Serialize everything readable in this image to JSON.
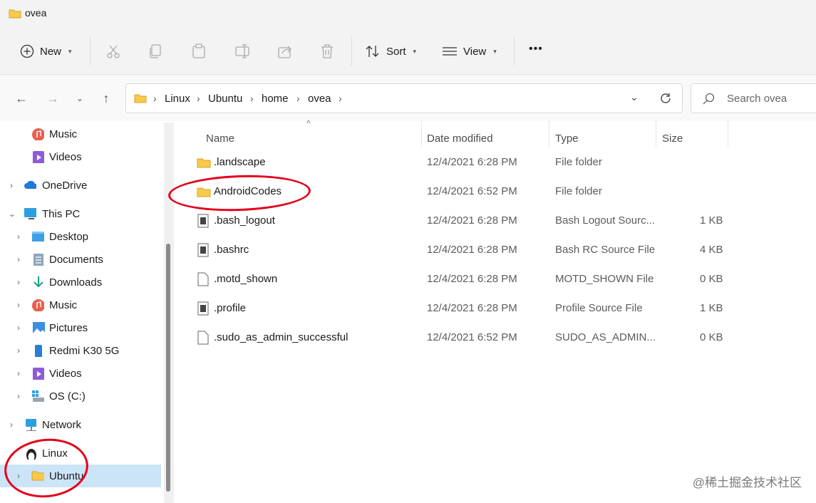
{
  "window": {
    "title": "ovea"
  },
  "toolbar": {
    "new_label": "New",
    "sort_label": "Sort",
    "view_label": "View",
    "more_label": "•••"
  },
  "address": {
    "crumbs": [
      "Linux",
      "Ubuntu",
      "home",
      "ovea"
    ],
    "search_placeholder": "Search ovea"
  },
  "sidebar": {
    "items": [
      {
        "label": "Music",
        "icon": "music-icon"
      },
      {
        "label": "Videos",
        "icon": "videos-icon"
      },
      {
        "label": "OneDrive",
        "icon": "cloud-icon"
      },
      {
        "label": "This PC",
        "icon": "computer-icon"
      },
      {
        "label": "Desktop",
        "icon": "desktop-icon"
      },
      {
        "label": "Documents",
        "icon": "documents-icon"
      },
      {
        "label": "Downloads",
        "icon": "downloads-icon"
      },
      {
        "label": "Music",
        "icon": "music-icon"
      },
      {
        "label": "Pictures",
        "icon": "pictures-icon"
      },
      {
        "label": "Redmi K30 5G",
        "icon": "phone-icon"
      },
      {
        "label": "Videos",
        "icon": "videos-icon"
      },
      {
        "label": "OS (C:)",
        "icon": "drive-icon"
      },
      {
        "label": "Network",
        "icon": "network-icon"
      },
      {
        "label": "Linux",
        "icon": "linux-icon"
      },
      {
        "label": "Ubuntu",
        "icon": "folder-icon"
      }
    ]
  },
  "columns": {
    "name": "Name",
    "date": "Date modified",
    "type": "Type",
    "size": "Size"
  },
  "files": [
    {
      "name": ".landscape",
      "date": "12/4/2021 6:28 PM",
      "type": "File folder",
      "size": "",
      "icon": "folder-icon"
    },
    {
      "name": "AndroidCodes",
      "date": "12/4/2021 6:52 PM",
      "type": "File folder",
      "size": "",
      "icon": "folder-icon"
    },
    {
      "name": ".bash_logout",
      "date": "12/4/2021 6:28 PM",
      "type": "Bash Logout Sourc...",
      "size": "1 KB",
      "icon": "text-file-icon"
    },
    {
      "name": ".bashrc",
      "date": "12/4/2021 6:28 PM",
      "type": "Bash RC Source File",
      "size": "4 KB",
      "icon": "text-file-icon"
    },
    {
      "name": ".motd_shown",
      "date": "12/4/2021 6:28 PM",
      "type": "MOTD_SHOWN File",
      "size": "0 KB",
      "icon": "blank-file-icon"
    },
    {
      "name": ".profile",
      "date": "12/4/2021 6:28 PM",
      "type": "Profile Source File",
      "size": "1 KB",
      "icon": "text-file-icon"
    },
    {
      "name": ".sudo_as_admin_successful",
      "date": "12/4/2021 6:52 PM",
      "type": "SUDO_AS_ADMIN...",
      "size": "0 KB",
      "icon": "blank-file-icon"
    }
  ],
  "watermark": "@稀土掘金技术社区"
}
